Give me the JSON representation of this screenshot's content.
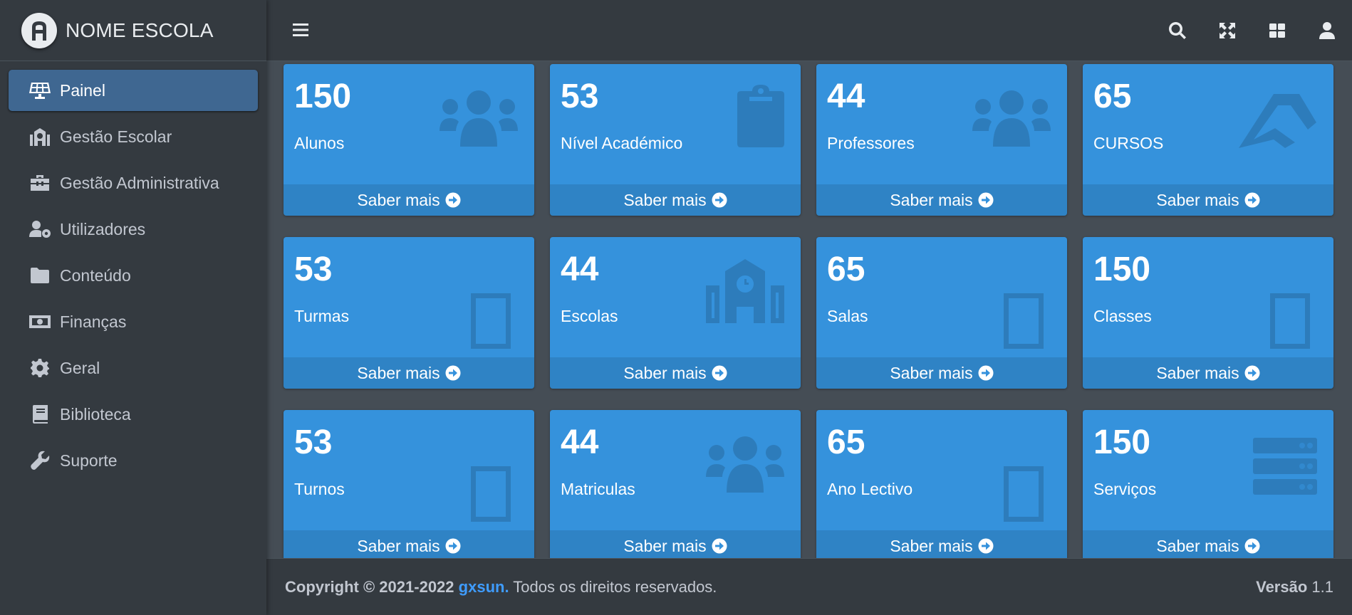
{
  "brand": {
    "name": "NOME ESCOLA",
    "logo_icon": "school-logo-icon"
  },
  "sidebar": {
    "items": [
      {
        "label": "Painel",
        "icon": "solar-panel-icon",
        "active": true
      },
      {
        "label": "Gestão Escolar",
        "icon": "school-icon"
      },
      {
        "label": "Gestão Administrativa",
        "icon": "toolbox-icon"
      },
      {
        "label": "Utilizadores",
        "icon": "users-cog-icon"
      },
      {
        "label": "Conteúdo",
        "icon": "folder-icon"
      },
      {
        "label": "Finanças",
        "icon": "money-bill-icon"
      },
      {
        "label": "Geral",
        "icon": "gear-icon"
      },
      {
        "label": "Biblioteca",
        "icon": "book-icon"
      },
      {
        "label": "Suporte",
        "icon": "wrench-icon"
      }
    ]
  },
  "topbar": {
    "icons": [
      "menu-icon",
      "search-icon",
      "fullscreen-icon",
      "grid-icon",
      "user-icon"
    ]
  },
  "cards": [
    {
      "value": "150",
      "label": "Alunos",
      "icon": "users-icon",
      "footer": "Saber mais"
    },
    {
      "value": "53",
      "label": "Nível Académico",
      "icon": "clipboard-icon",
      "footer": "Saber mais"
    },
    {
      "value": "44",
      "label": "Professores",
      "icon": "users-icon",
      "footer": "Saber mais"
    },
    {
      "value": "65",
      "label": "CURSOS",
      "icon": "graduation-icon",
      "footer": "Saber mais"
    },
    {
      "value": "53",
      "label": "Turmas",
      "icon": "missing-glyph-icon",
      "footer": "Saber mais"
    },
    {
      "value": "44",
      "label": "Escolas",
      "icon": "school-icon",
      "footer": "Saber mais"
    },
    {
      "value": "65",
      "label": "Salas",
      "icon": "missing-glyph-icon",
      "footer": "Saber mais"
    },
    {
      "value": "150",
      "label": "Classes",
      "icon": "missing-glyph-icon",
      "footer": "Saber mais"
    },
    {
      "value": "53",
      "label": "Turnos",
      "icon": "missing-glyph-icon",
      "footer": "Saber mais"
    },
    {
      "value": "44",
      "label": "Matriculas",
      "icon": "users-icon",
      "footer": "Saber mais"
    },
    {
      "value": "65",
      "label": "Ano Lectivo",
      "icon": "missing-glyph-icon",
      "footer": "Saber mais"
    },
    {
      "value": "150",
      "label": "Serviços",
      "icon": "server-icon",
      "footer": "Saber mais"
    }
  ],
  "footer": {
    "copyright": "Copyright © 2021-2022",
    "company": "gxsun.",
    "rights": "Todos os direitos reservados.",
    "version_label": "Versão",
    "version_value": "1.1"
  },
  "colors": {
    "sidebar_bg": "#343a40",
    "content_bg": "#454d55",
    "card_bg": "#3592dc",
    "active_item": "#3f6791",
    "link": "#3f9cff"
  }
}
